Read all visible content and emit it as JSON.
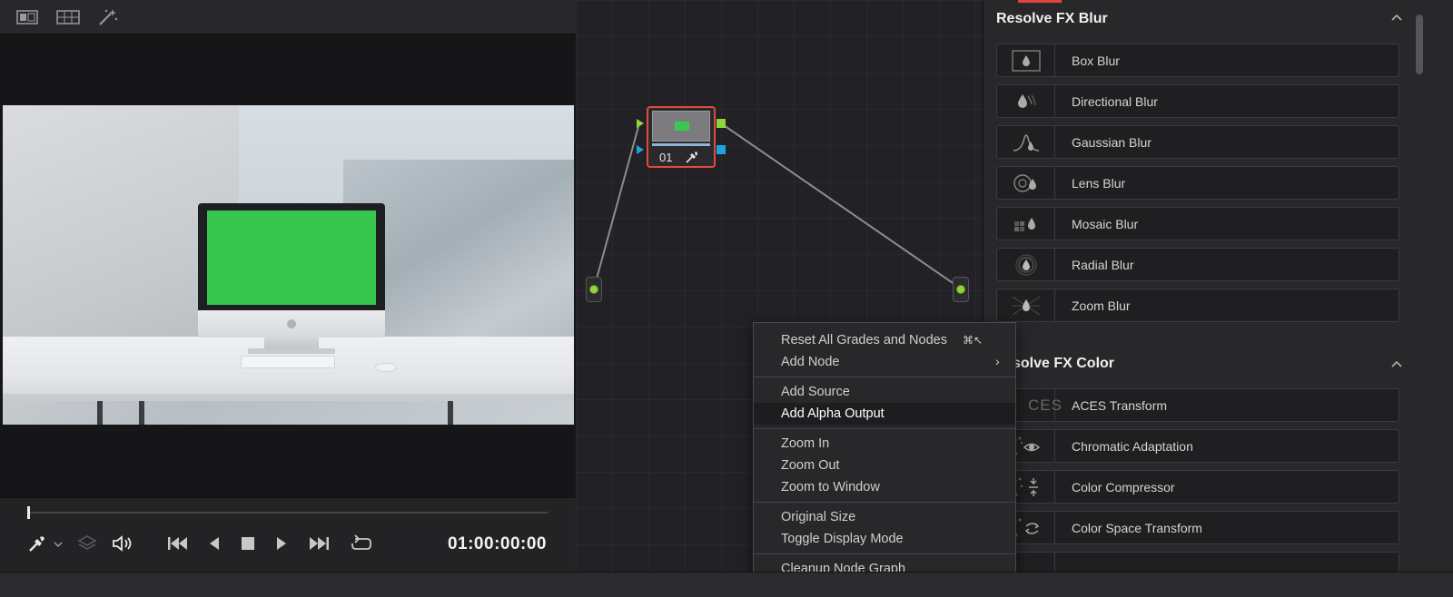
{
  "viewer": {
    "toolbar": {
      "icons": [
        "compare-view-icon",
        "gallery-grid-icon",
        "magic-wand-icon"
      ]
    },
    "timecode": "01:00:00:00",
    "playhead_fraction": 0.0
  },
  "node_graph": {
    "node": {
      "label": "01"
    }
  },
  "context_menu": {
    "items": [
      {
        "label": "Reset All Grades and Nodes",
        "shortcut": "⌘↖"
      },
      {
        "label": "Add Node",
        "submenu": "›"
      },
      {
        "label": "Add Source"
      },
      {
        "label": "Add Alpha Output",
        "highlighted": true
      },
      {
        "label": "Zoom In"
      },
      {
        "label": "Zoom Out"
      },
      {
        "label": "Zoom to Window"
      },
      {
        "label": "Original Size"
      },
      {
        "label": "Toggle Display Mode"
      },
      {
        "label": "Cleanup Node Graph"
      }
    ]
  },
  "fx_panel": {
    "sections": [
      {
        "title": "Resolve FX Blur",
        "items": [
          "Box Blur",
          "Directional Blur",
          "Gaussian Blur",
          "Lens Blur",
          "Mosaic Blur",
          "Radial Blur",
          "Zoom Blur"
        ]
      },
      {
        "title": "solve FX Color",
        "items": [
          "ACES Transform",
          "Chromatic Adaptation",
          "Color Compressor",
          "Color Space Transform"
        ]
      }
    ],
    "aces_icon_text": "CES"
  },
  "colors": {
    "accent_red": "#e2463b",
    "node_green": "#8fd43a",
    "port_blue": "#1fa3e0",
    "screen_green": "#36c54d"
  }
}
